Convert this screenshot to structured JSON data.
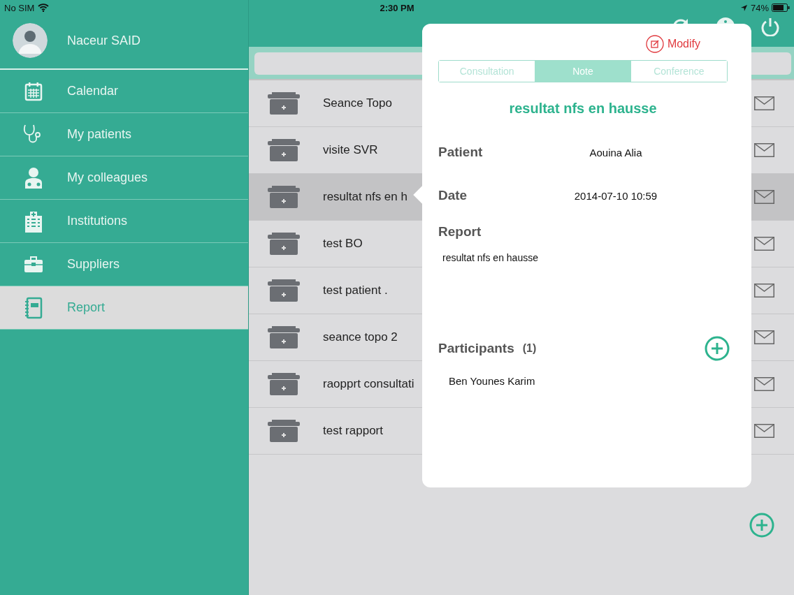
{
  "status_bar": {
    "carrier": "No SIM",
    "time": "2:30 PM",
    "battery": "74%"
  },
  "profile": {
    "name": "Naceur SAID"
  },
  "sidebar": {
    "items": [
      {
        "label": "Calendar",
        "kind": "calendar",
        "selected": false
      },
      {
        "label": "My patients",
        "kind": "stethoscope",
        "selected": false
      },
      {
        "label": "My colleagues",
        "kind": "doctor",
        "selected": false
      },
      {
        "label": "Institutions",
        "kind": "hospital",
        "selected": false
      },
      {
        "label": "Suppliers",
        "kind": "briefcase",
        "selected": false
      },
      {
        "label": "Report",
        "kind": "notebook",
        "selected": true
      }
    ]
  },
  "reports": [
    {
      "title": "Seance Topo",
      "selected": false
    },
    {
      "title": "visite SVR",
      "selected": false
    },
    {
      "title": "resultat nfs en h",
      "selected": true
    },
    {
      "title": "test BO",
      "selected": false
    },
    {
      "title": "test patient .",
      "selected": false
    },
    {
      "title": "seance topo 2",
      "selected": false
    },
    {
      "title": "raopprt consultati",
      "selected": false
    },
    {
      "title": "test rapport",
      "selected": false
    }
  ],
  "popover": {
    "modify": "Modify",
    "tabs": [
      {
        "label": "Consultation",
        "selected": false
      },
      {
        "label": "Note",
        "selected": true
      },
      {
        "label": "Conference",
        "selected": false
      }
    ],
    "title": "resultat nfs en hausse",
    "fields": [
      {
        "label": "Patient",
        "value": "Aouina Alia"
      },
      {
        "label": "Date",
        "value": "2014-07-10 10:59"
      }
    ],
    "report": {
      "label": "Report",
      "text": "resultat nfs en hausse"
    },
    "participants": {
      "label": "Participants",
      "count": "(1)",
      "items": [
        "Ben Younes Karim"
      ]
    }
  }
}
